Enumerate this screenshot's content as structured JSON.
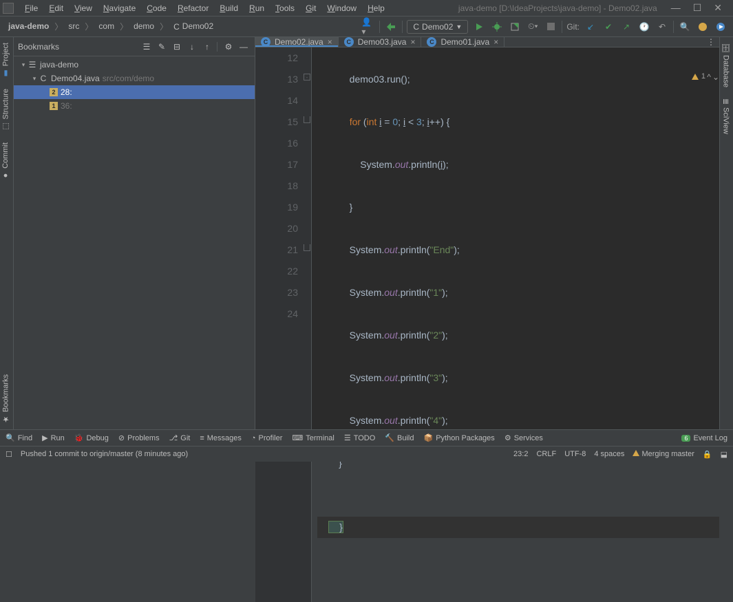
{
  "window": {
    "title": "java-demo [D:\\IdeaProjects\\java-demo] - Demo02.java"
  },
  "menu": {
    "file": "File",
    "edit": "Edit",
    "view": "View",
    "navigate": "Navigate",
    "code": "Code",
    "refactor": "Refactor",
    "build": "Build",
    "run": "Run",
    "tools": "Tools",
    "git": "Git",
    "window": "Window",
    "help": "Help"
  },
  "breadcrumb": {
    "c0": "java-demo",
    "c1": "src",
    "c2": "com",
    "c3": "demo",
    "c4": "Demo02"
  },
  "runConfig": {
    "label": "Demo02"
  },
  "navbar": {
    "gitLabel": "Git:"
  },
  "leftGutter": {
    "project": "Project",
    "structure": "Structure",
    "commit": "Commit",
    "bookmarks": "Bookmarks"
  },
  "rightGutter": {
    "database": "Database",
    "sciview": "SciView"
  },
  "tool": {
    "title": "Bookmarks",
    "tree": {
      "root": "java-demo",
      "file": "Demo04.java",
      "fileLoc": "src/com/demo",
      "bm1": {
        "badge": "2",
        "label": "28:"
      },
      "bm2": {
        "badge": "1",
        "label": "36:"
      }
    }
  },
  "tabs": {
    "t0": "Demo02.java",
    "t1": "Demo03.java",
    "t2": "Demo01.java"
  },
  "editor": {
    "lines": [
      "12",
      "13",
      "14",
      "15",
      "16",
      "17",
      "18",
      "19",
      "20",
      "21",
      "22",
      "23",
      "24"
    ],
    "warnCount": "1"
  },
  "code": {
    "l12a": "            demo03.",
    "l12b": "run",
    "l12c": "();",
    "l13a": "            ",
    "l13for": "for ",
    "l13p1": "(",
    "l13int": "int ",
    "l13i1": "i",
    "l13eq": " = ",
    "l13n0": "0",
    "l13s1": "; ",
    "l13i2": "i",
    "l13lt": " < ",
    "l13n3": "3",
    "l13s2": "; ",
    "l13i3": "i",
    "l13inc": "++) {",
    "l14a": "                System.",
    "l14out": "out",
    "l14b": ".println(",
    "l14i": "i",
    "l14c": ");",
    "l15": "            }",
    "l16a": "            System.",
    "l16out": "out",
    "l16b": ".println(",
    "l16s": "\"End\"",
    "l16c": ");",
    "l17a": "            System.",
    "l17out": "out",
    "l17b": ".println(",
    "l17s": "\"1\"",
    "l17c": ");",
    "l18a": "            System.",
    "l18out": "out",
    "l18b": ".println(",
    "l18s": "\"2\"",
    "l18c": ");",
    "l19a": "            System.",
    "l19out": "out",
    "l19b": ".println(",
    "l19s": "\"3\"",
    "l19c": ");",
    "l20a": "            System.",
    "l20out": "out",
    "l20b": ".println(",
    "l20s": "\"4\"",
    "l20c": ");",
    "l21": "        }",
    "l22": "",
    "l23": "    }",
    "l24": ""
  },
  "bottom": {
    "find": "Find",
    "run": "Run",
    "debug": "Debug",
    "problems": "Problems",
    "git": "Git",
    "messages": "Messages",
    "profiler": "Profiler",
    "terminal": "Terminal",
    "todo": "TODO",
    "build": "Build",
    "pypkg": "Python Packages",
    "services": "Services",
    "eventlog": "Event Log",
    "eventBadge": "6"
  },
  "status": {
    "msg": "Pushed 1 commit to origin/master (8 minutes ago)",
    "pos": "23:2",
    "eol": "CRLF",
    "enc": "UTF-8",
    "indent": "4 spaces",
    "merge": "Merging master"
  }
}
